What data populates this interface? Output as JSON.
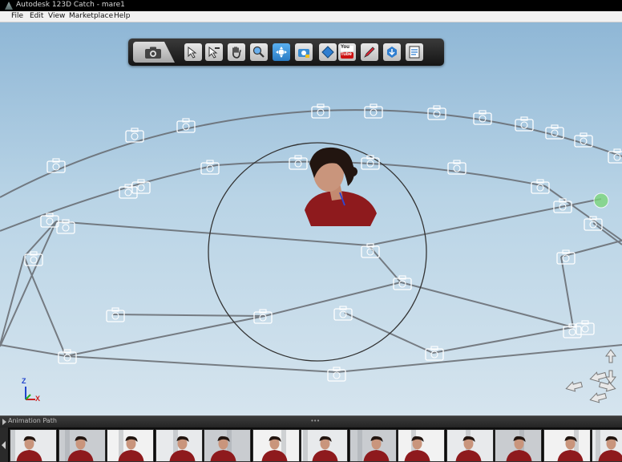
{
  "window": {
    "title": "Autodesk 123D Catch - mare1"
  },
  "menu": {
    "items": [
      "File",
      "Edit",
      "View",
      "Marketplace",
      "Help"
    ]
  },
  "toolbar": {
    "tools": [
      {
        "name": "select-tool",
        "icon": "cursor-icon"
      },
      {
        "name": "deselect-tool",
        "icon": "cursor-minus-icon"
      },
      {
        "name": "pan-tool",
        "icon": "hand-icon"
      },
      {
        "name": "zoom-tool",
        "icon": "zoom-icon"
      },
      {
        "name": "orbit-tool",
        "icon": "orbit-icon",
        "active": true
      },
      {
        "name": "camera-view-tool",
        "icon": "camera-view-icon"
      },
      {
        "name": "material-tool",
        "icon": "diamond-icon"
      },
      {
        "name": "youtube-tool",
        "icon": "youtube-icon",
        "text_top": "You",
        "text_bottom": "Tube"
      },
      {
        "name": "stitch-tool",
        "icon": "pencil-icon"
      },
      {
        "name": "export-tool",
        "icon": "export-icon"
      },
      {
        "name": "notes-tool",
        "icon": "notes-icon"
      }
    ]
  },
  "viewport": {
    "colors": {
      "sky_top": "#8fb7d6",
      "sky_bottom": "#d5e4ee",
      "path_line": "#666a70",
      "camera": "#ffffff",
      "orbit_circle": "#333333",
      "selection": "#7cd67c"
    }
  },
  "axis_gizmo": {
    "x": "X",
    "y": "Y",
    "z": "Z"
  },
  "animation_panel": {
    "label": "Animation Path",
    "grip": "•••"
  },
  "filmstrip": {
    "thumbnail_count": 13
  }
}
